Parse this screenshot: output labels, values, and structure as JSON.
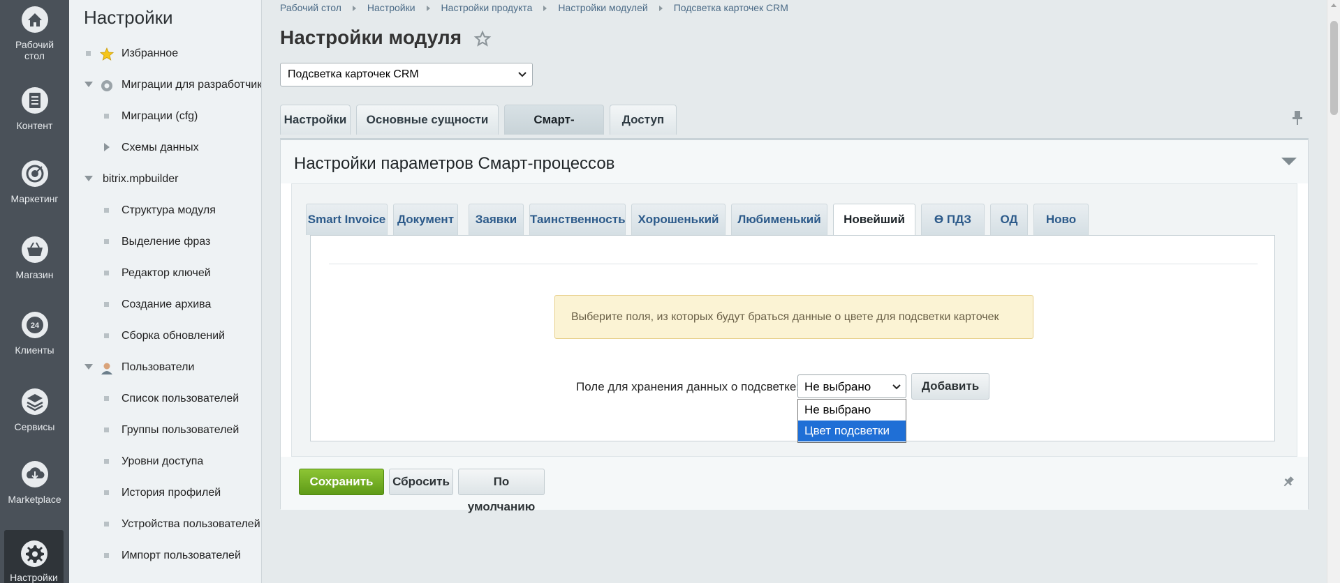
{
  "leftnav": {
    "items": [
      {
        "label": "Рабочий стол",
        "icon": "home-icon"
      },
      {
        "label": "Контент",
        "icon": "document-icon"
      },
      {
        "label": "Маркетинг",
        "icon": "target-icon"
      },
      {
        "label": "Магазин",
        "icon": "basket-icon"
      },
      {
        "label": "Клиенты",
        "icon": "clock-24-icon"
      },
      {
        "label": "Сервисы",
        "icon": "layers-icon"
      },
      {
        "label": "Marketplace",
        "icon": "cloud-download-icon"
      },
      {
        "label": "Настройки",
        "icon": "gear-icon",
        "active": true
      }
    ]
  },
  "submenu": {
    "title": "Настройки",
    "items": [
      {
        "label": "Избранное",
        "icon": "star-icon"
      },
      {
        "label": "Миграции для разработчиков",
        "icon": "gear-icon"
      },
      {
        "label": "Миграции (cfg)"
      },
      {
        "label": "Схемы данных"
      },
      {
        "label": "bitrix.mpbuilder"
      },
      {
        "label": "Структура модуля"
      },
      {
        "label": "Выделение фраз"
      },
      {
        "label": "Редактор ключей"
      },
      {
        "label": "Создание архива"
      },
      {
        "label": "Сборка обновлений"
      },
      {
        "label": "Пользователи",
        "icon": "user-icon"
      },
      {
        "label": "Список пользователей"
      },
      {
        "label": "Группы пользователей"
      },
      {
        "label": "Уровни доступа"
      },
      {
        "label": "История профилей"
      },
      {
        "label": "Устройства пользователей"
      },
      {
        "label": "Импорт пользователей"
      }
    ]
  },
  "breadcrumb": [
    "Рабочий стол",
    "Настройки",
    "Настройки продукта",
    "Настройки модулей",
    "Подсветка карточек CRM"
  ],
  "page": {
    "title": "Настройки модуля",
    "module_select_value": "Подсветка карточек CRM"
  },
  "main_tabs": [
    {
      "label": "Настройки"
    },
    {
      "label": "Основные сущности"
    },
    {
      "label": "Смарт-процессы",
      "active": true
    },
    {
      "label": "Доступ"
    }
  ],
  "panel": {
    "title": "Настройки параметров Смарт-процессов",
    "inner_tabs": [
      {
        "label": "Smart Invoice"
      },
      {
        "label": "Документ"
      },
      {
        "label": "Заявки"
      },
      {
        "label": "Таинственность"
      },
      {
        "label": "Хорошенький"
      },
      {
        "label": "Любименький"
      },
      {
        "label": "Новейший",
        "active": true
      },
      {
        "label": "ϴ ПДЗ"
      },
      {
        "label": "ОД"
      },
      {
        "label": "Ново"
      }
    ],
    "notice": "Выберите поля, из которых будут браться данные о цвете для подсветки карточек",
    "field_label": "Поле для хранения данных о подсветке:",
    "field_value": "Не выбрано",
    "add_button": "Добавить",
    "dropdown_options": [
      "Не выбрано",
      "Цвет подсветки"
    ],
    "dropdown_highlighted": "Цвет подсветки"
  },
  "buttons": {
    "save": "Сохранить",
    "reset": "Сбросить",
    "default": "По умолчанию"
  },
  "colors": {
    "save_green": "#6aa81f",
    "link_blue": "#2c5a8a",
    "nav_dark": "#4a5159",
    "highlight_blue": "#1f6fd6"
  }
}
